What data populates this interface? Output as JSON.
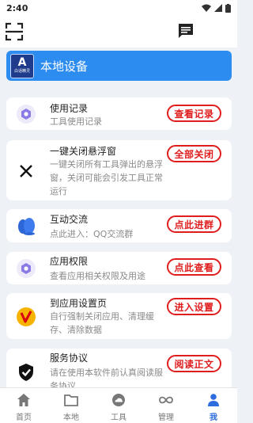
{
  "status_bar": {
    "time": "2:40"
  },
  "banner": {
    "logo_letter": "A",
    "logo_caption": "白话精灵",
    "title": "本地设备"
  },
  "cards": [
    {
      "title": "使用记录",
      "desc": "工具使用记录",
      "button": "查看记录",
      "icon": "hexagon-gear-icon"
    },
    {
      "title": "一键关闭悬浮窗",
      "desc": "一键关闭所有工具弹出的悬浮窗，关闭可能会引发工具正常运行",
      "button": "全部关闭",
      "icon": "close-x-icon"
    },
    {
      "title": "互动交流",
      "desc": "点此进入：QQ交流群",
      "button": "点此进群",
      "icon": "qq-penguin-icon"
    },
    {
      "title": "应用权限",
      "desc": "查看应用相关权限及用途",
      "button": "点此查看",
      "icon": "hexagon-gear-icon"
    },
    {
      "title": "到应用设置页",
      "desc": "自行强制关闭应用、清理缓存、清除数据",
      "button": "进入设置",
      "icon": "v-badge-icon"
    },
    {
      "title": "服务协议",
      "desc": "请在使用本软件前认真阅读服务协议",
      "button": "阅读正文",
      "icon": "shield-check-icon"
    }
  ],
  "nav": [
    {
      "label": "首页",
      "icon": "home-icon"
    },
    {
      "label": "本地",
      "icon": "folder-icon"
    },
    {
      "label": "工具",
      "icon": "cloud-icon"
    },
    {
      "label": "管理",
      "icon": "infinity-icon"
    },
    {
      "label": "我",
      "icon": "person-icon",
      "active": true
    }
  ],
  "colors": {
    "accent": "#2d8cf0",
    "button_red": "#e01d1d",
    "nav_active": "#2d6cdf"
  }
}
